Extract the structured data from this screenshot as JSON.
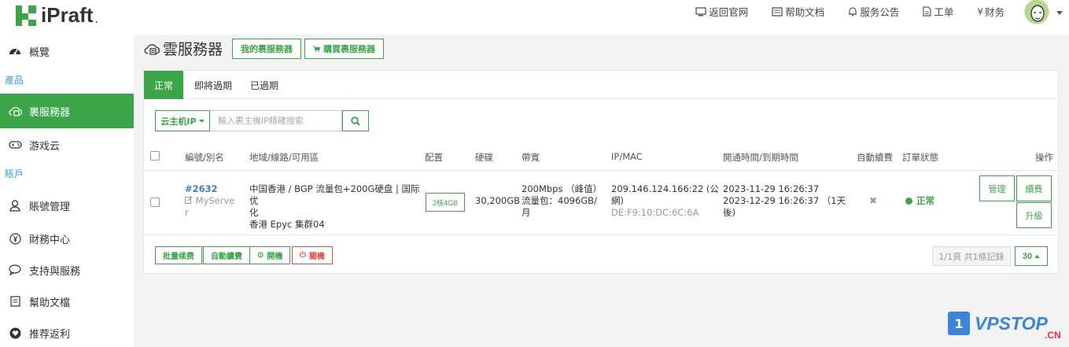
{
  "brand": {
    "name": "iPraft",
    "accent": "#3aa647"
  },
  "topnav": [
    {
      "label": "返回官网",
      "icon": "monitor-icon"
    },
    {
      "label": "帮助文档",
      "icon": "book-icon"
    },
    {
      "label": "服务公告",
      "icon": "bell-icon"
    },
    {
      "label": "工单",
      "icon": "document-icon"
    },
    {
      "label": "财务",
      "icon": "yen-icon"
    }
  ],
  "sidebar": {
    "items": [
      {
        "label": "概覽",
        "icon": "dashboard-icon"
      },
      {
        "label": "產品",
        "section": true
      },
      {
        "label": "裹服務器",
        "icon": "cloud-server-icon",
        "active": true
      },
      {
        "label": "游戏云",
        "icon": "gamepad-icon"
      },
      {
        "label": "賬戶",
        "section": true
      },
      {
        "label": "賬號管理",
        "icon": "user-icon"
      },
      {
        "label": "財務中心",
        "icon": "yen-circle-icon"
      },
      {
        "label": "支持與服務",
        "icon": "chat-icon"
      },
      {
        "label": "幫助文檔",
        "icon": "doc-icon"
      },
      {
        "label": "推荐返利",
        "icon": "heart-icon"
      }
    ]
  },
  "page": {
    "title": "雲服務器",
    "my_servers_btn": "我的裹服務器",
    "buy_servers_btn": "購買裹服務器"
  },
  "tabs": [
    {
      "label": "正常",
      "active": true
    },
    {
      "label": "即將過期"
    },
    {
      "label": "已過期"
    }
  ],
  "search": {
    "filter_label": "云主机IP",
    "placeholder": "輸入裹主機IP精確搜索"
  },
  "table": {
    "headers": {
      "id": "編號/別名",
      "region": "地域/線路/可用區",
      "config": "配置",
      "disk": "硬碟",
      "bandwidth": "帶寬",
      "ipmac": "IP/MAC",
      "time": "開通時間/到期時間",
      "autorenew": "自動續費",
      "status": "訂單狀態",
      "action": "操作"
    },
    "rows": [
      {
        "id": "#2632",
        "alias_1": "MyServe",
        "alias_2": "r",
        "region_1": "中国香港 / BGP 流量包+200G硬盘 | 国际优",
        "region_2": "化",
        "region_3": "香港 Epyc 集群04",
        "config": "2核4GB",
        "disk": "30,200GB",
        "bw_1": "200Mbps （峰值）",
        "bw_2": "流量包：4096GB/",
        "bw_3": "月",
        "ip_1": "209.146.124.166:22 (公",
        "ip_2": "網)",
        "mac": "DE:F9:10:DC:6C:6A",
        "open_time": "2023-11-29 16:26:37",
        "expire_1": "2023-12-29 16:26:37 （1天",
        "expire_2": "後)",
        "autorenew": "✖",
        "status": "正常",
        "btn_manage": "管理",
        "btn_renew": "續費",
        "btn_upgrade": "升級"
      }
    ]
  },
  "footer": {
    "batch_renew": "批量续费",
    "auto_renew": "自動續費",
    "power_on": "開機",
    "power_off": "關機",
    "pager_info": "1/1頁 共1條記錄",
    "per_page": "30"
  },
  "watermark": {
    "box": "1",
    "text": "VPSTOP",
    "sub": ".CN"
  }
}
